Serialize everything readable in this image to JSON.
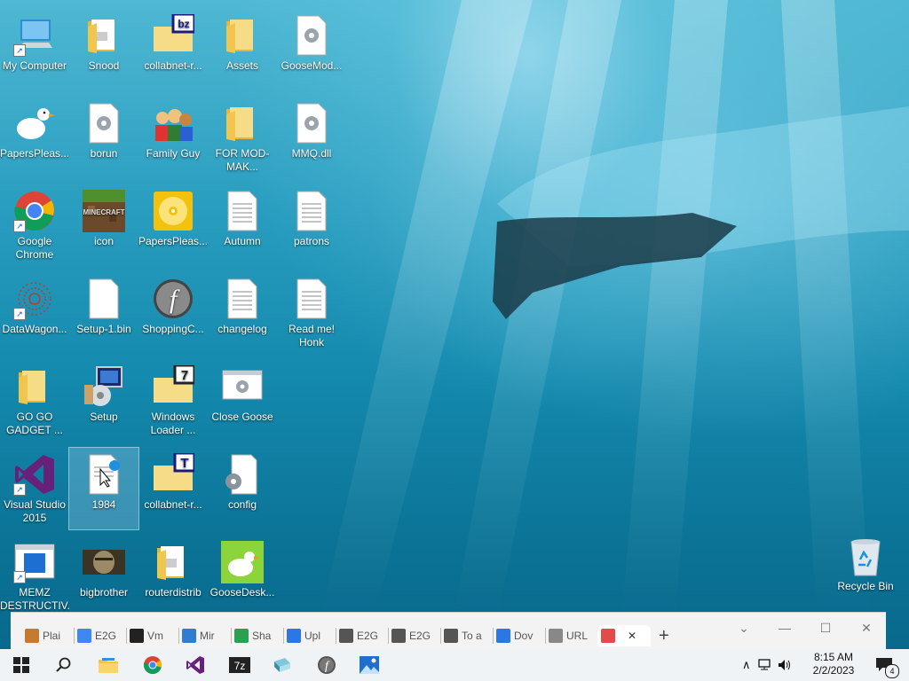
{
  "desktop_icons": [
    {
      "label": "My Computer"
    },
    {
      "label": "Snood"
    },
    {
      "label": "collabnet-r..."
    },
    {
      "label": "Assets"
    },
    {
      "label": "GooseMod..."
    },
    {
      "label": "PapersPleas..."
    },
    {
      "label": "borun"
    },
    {
      "label": "Family Guy"
    },
    {
      "label": "FOR MOD-MAK..."
    },
    {
      "label": "MMQ.dll"
    },
    {
      "label": "Google Chrome"
    },
    {
      "label": "icon"
    },
    {
      "label": "PapersPleas..."
    },
    {
      "label": "Autumn"
    },
    {
      "label": "patrons"
    },
    {
      "label": "DataWagon..."
    },
    {
      "label": "Setup-1.bin"
    },
    {
      "label": "ShoppingC..."
    },
    {
      "label": "changelog"
    },
    {
      "label": "Read me! Honk"
    },
    {
      "label": "GO GO GADGET ..."
    },
    {
      "label": "Setup"
    },
    {
      "label": "Windows Loader ..."
    },
    {
      "label": "Close Goose"
    },
    {
      "label": "Visual Studio 2015"
    },
    {
      "label": "1984"
    },
    {
      "label": "collabnet-r..."
    },
    {
      "label": "config"
    },
    {
      "label": "MEMZ DESTRUCTIV..."
    },
    {
      "label": "bigbrother"
    },
    {
      "label": "routerdistrib"
    },
    {
      "label": "GooseDesk..."
    },
    {
      "label": "Recycle Bin"
    }
  ],
  "browser_tabs": [
    {
      "label": "Plai"
    },
    {
      "label": "E2G"
    },
    {
      "label": "Vm"
    },
    {
      "label": "Mir"
    },
    {
      "label": "Sha"
    },
    {
      "label": "Upl"
    },
    {
      "label": "E2G"
    },
    {
      "label": "E2G"
    },
    {
      "label": "To a"
    },
    {
      "label": "Dov"
    },
    {
      "label": "URL"
    },
    {
      "label": ""
    }
  ],
  "browser": {
    "new_tab": "+",
    "close_tab": "✕",
    "minimize": "—",
    "restore": "☐",
    "close": "✕",
    "chevron": "⌄"
  },
  "taskbar": {
    "time": "8:15 AM",
    "date": "2/2/2023",
    "notification_count": "4"
  },
  "colors": {
    "selection": "#cfe6ff",
    "taskbar": "#f0f3f6",
    "accent": "#0078d7"
  }
}
